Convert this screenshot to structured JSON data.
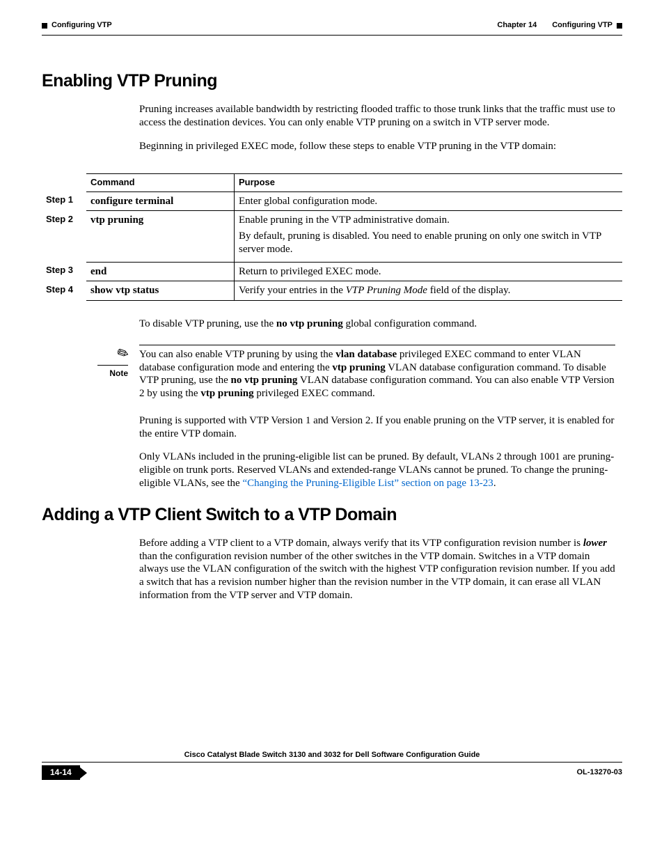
{
  "header": {
    "chapter_label": "Chapter 14",
    "chapter_title": "Configuring VTP",
    "section_running": "Configuring VTP"
  },
  "section1": {
    "title": "Enabling VTP Pruning",
    "p1": "Pruning increases available bandwidth by restricting flooded traffic to those trunk links that the traffic must use to access the destination devices. You can only enable VTP pruning on a switch in VTP server mode.",
    "p2": "Beginning in privileged EXEC mode, follow these steps to enable VTP pruning in the VTP domain:",
    "table": {
      "head_step": "",
      "head_cmd": "Command",
      "head_purpose": "Purpose",
      "rows": [
        {
          "step": "Step 1",
          "cmd": "configure terminal",
          "purpose": "Enter global configuration mode."
        },
        {
          "step": "Step 2",
          "cmd": "vtp pruning",
          "purpose": "Enable pruning in the VTP administrative domain.",
          "purpose2": "By default, pruning is disabled. You need to enable pruning on only one switch in VTP server mode."
        },
        {
          "step": "Step 3",
          "cmd": "end",
          "purpose": "Return to privileged EXEC mode."
        },
        {
          "step": "Step 4",
          "cmd": "show vtp status",
          "purpose_pre": "Verify your entries in the ",
          "purpose_em": "VTP Pruning Mode",
          "purpose_post": " field of the display."
        }
      ]
    },
    "p3_pre": "To disable VTP pruning, use the ",
    "p3_cmd": "no vtp pruning",
    "p3_post": " global configuration command.",
    "note_label": "Note",
    "note_t1": "You can also enable VTP pruning by using the ",
    "note_c1": "vlan database",
    "note_t2": " privileged EXEC command to enter VLAN database configuration mode and entering the ",
    "note_c2": "vtp pruning",
    "note_t3": " VLAN database configuration command. To disable VTP pruning, use the ",
    "note_c3": "no vtp pruning",
    "note_t4": " VLAN database configuration command. You can also enable VTP Version 2 by using the ",
    "note_c4": "vtp pruning",
    "note_t5": " privileged EXEC command.",
    "p4": "Pruning is supported with VTP Version 1 and Version 2. If you enable pruning on the VTP server, it is enabled for the entire VTP domain.",
    "p5_pre": "Only VLANs included in the pruning-eligible list can be pruned. By default, VLANs 2 through 1001 are pruning-eligible on trunk ports. Reserved VLANs and extended-range VLANs cannot be pruned. To change the pruning-eligible VLANs, see the ",
    "p5_link": "“Changing the Pruning-Eligible List” section on page 13-23",
    "p5_post": "."
  },
  "section2": {
    "title": "Adding a VTP Client Switch to a VTP Domain",
    "p1_pre": "Before adding a VTP client to a VTP domain, always verify that its VTP configuration revision number is ",
    "p1_em": "lower",
    "p1_post": " than the configuration revision number of the other switches in the VTP domain. Switches in a VTP domain always use the VLAN configuration of the switch with the highest VTP configuration revision number. If you add a switch that has a revision number higher than the revision number in the VTP domain, it can erase all VLAN information from the VTP server and VTP domain."
  },
  "footer": {
    "book_title": "Cisco Catalyst Blade Switch 3130 and 3032 for Dell Software Configuration Guide",
    "page_num": "14-14",
    "doc_num": "OL-13270-03"
  }
}
